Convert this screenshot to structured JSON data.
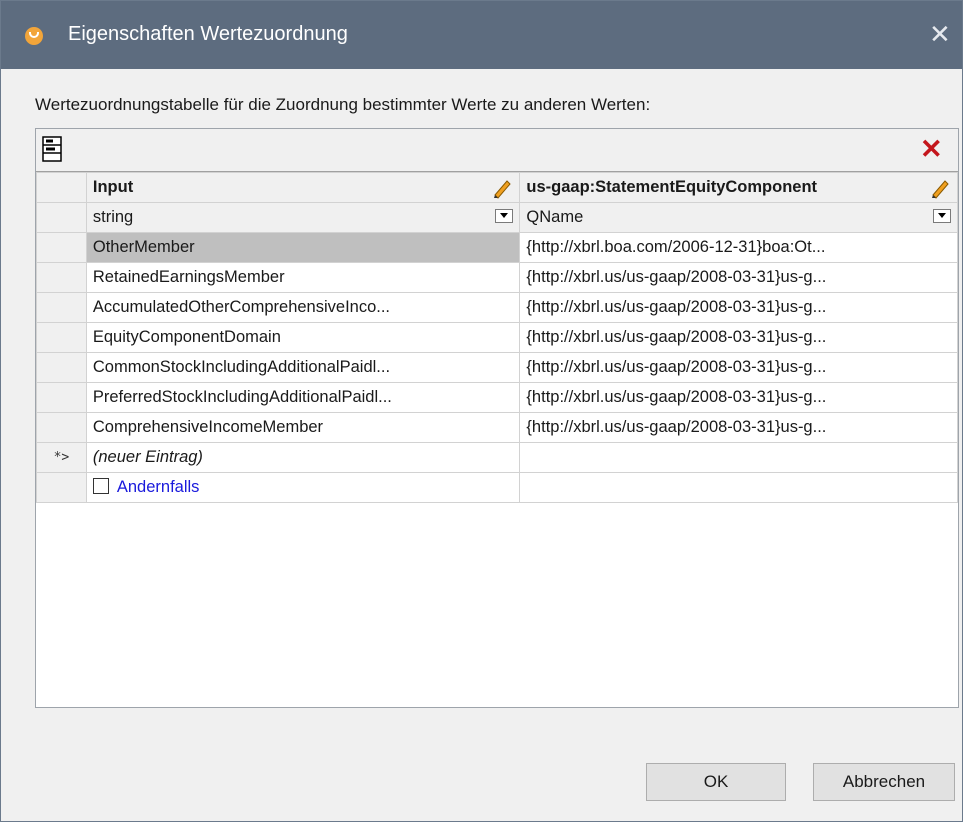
{
  "dialog": {
    "title": "Eigenschaften Wertezuordnung",
    "instruction": "Wertezuordnungstabelle für die Zuordnung bestimmter Werte zu anderen Werten:",
    "icons": {
      "app": "mapforce-app-icon",
      "close": "close-icon",
      "properties": "properties-icon",
      "delete": "delete-icon",
      "edit": "pencil-icon"
    },
    "colors": {
      "titlebar": "#5d6c7f",
      "delete": "#c4161c",
      "selected_row": "#bfbfbf",
      "otherwise_link": "#1a1adc"
    }
  },
  "table": {
    "columns": [
      {
        "header": "Input",
        "type": "string"
      },
      {
        "header": "us-gaap:StatementEquityComponent",
        "type": "QName"
      }
    ],
    "rows": [
      {
        "input": "OtherMember",
        "output": "{http://xbrl.boa.com/2006-12-31}boa:Ot...",
        "selected": true
      },
      {
        "input": "RetainedEarningsMember",
        "output": "{http://xbrl.us/us-gaap/2008-03-31}us-g..."
      },
      {
        "input": "AccumulatedOtherComprehensiveInco...",
        "output": "{http://xbrl.us/us-gaap/2008-03-31}us-g..."
      },
      {
        "input": "EquityComponentDomain",
        "output": "{http://xbrl.us/us-gaap/2008-03-31}us-g..."
      },
      {
        "input": "CommonStockIncludingAdditionalPaidl...",
        "output": "{http://xbrl.us/us-gaap/2008-03-31}us-g..."
      },
      {
        "input": "PreferredStockIncludingAdditionalPaidl...",
        "output": "{http://xbrl.us/us-gaap/2008-03-31}us-g..."
      },
      {
        "input": "ComprehensiveIncomeMember",
        "output": "{http://xbrl.us/us-gaap/2008-03-31}us-g..."
      }
    ],
    "new_entry_marker": "*>",
    "new_entry": "(neuer Eintrag)",
    "otherwise": {
      "label": "Andernfalls",
      "checked": false
    }
  },
  "buttons": {
    "ok": "OK",
    "cancel": "Abbrechen"
  }
}
